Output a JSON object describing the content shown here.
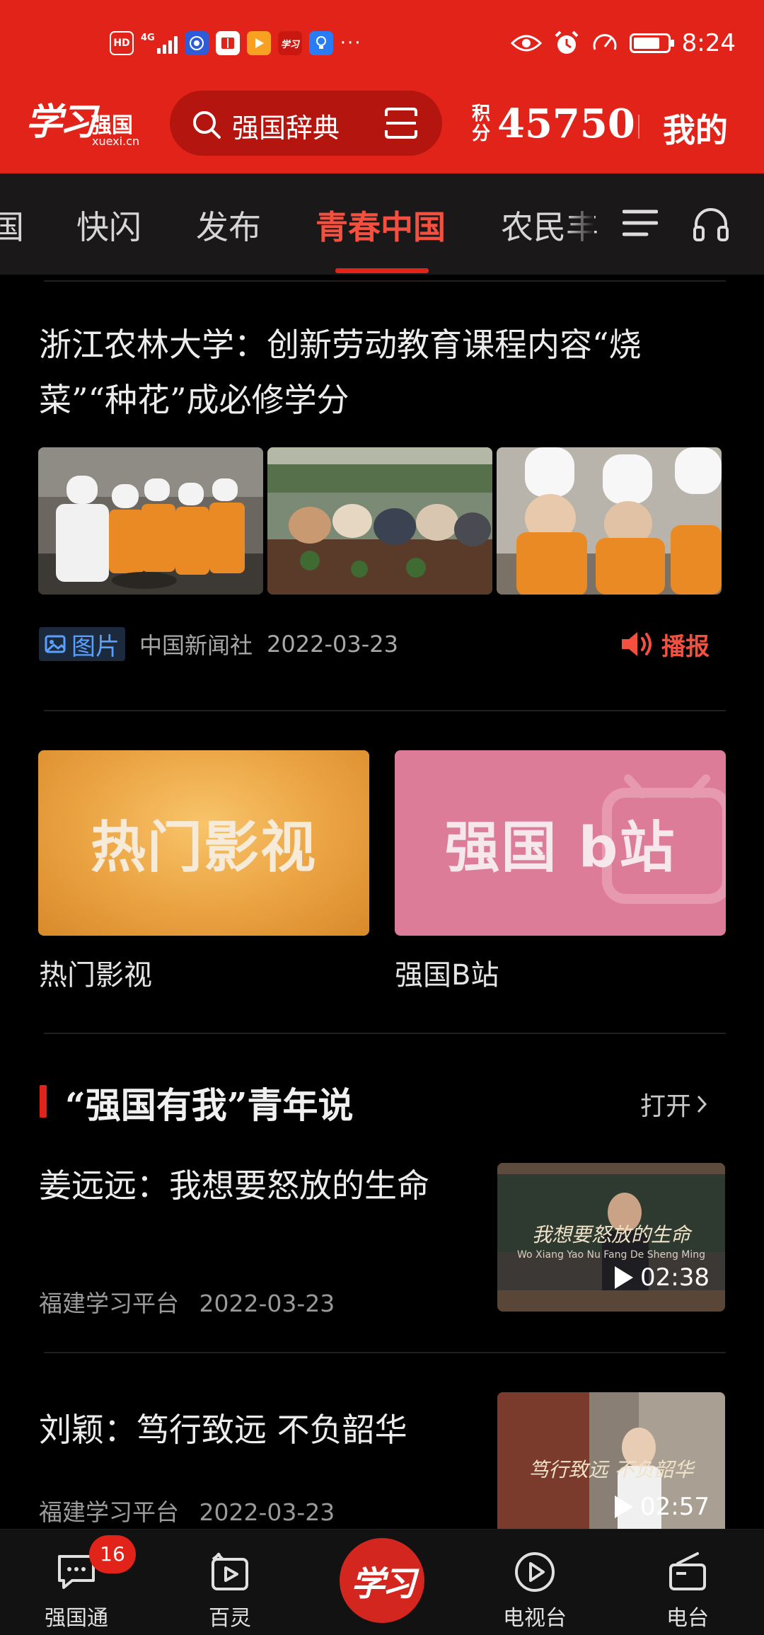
{
  "status_bar": {
    "time": "8:24",
    "network": "4G",
    "left_icons": [
      "hd-icon",
      "signal-icon",
      "app-blue-icon",
      "book-icon",
      "play-orange-icon",
      "xuexi-icon",
      "bulb-icon",
      "more-dots-icon"
    ],
    "hd_label": "HD",
    "battery_level": 0.7
  },
  "header": {
    "logo_script": "学习",
    "logo_name": "强国",
    "logo_url": "xuexi.cn",
    "search_text": "强国辞典",
    "points_label": "积分",
    "points_value": "45750",
    "mine_label": "我的"
  },
  "tabs": {
    "items": [
      "国",
      "快闪",
      "发布",
      "青春中国",
      "农民丰"
    ],
    "active_index": 3
  },
  "article": {
    "title": "浙江农林大学：创新劳动教育课程内容“烧菜”“种花”成必修学分",
    "tag_label": "图片",
    "source": "中国新闻社",
    "date": "2022-03-23",
    "broadcast_label": "播报"
  },
  "cards": [
    {
      "image_text": "热门影视",
      "label": "热门影视"
    },
    {
      "image_text": "强国 b站",
      "label": "强国B站"
    }
  ],
  "section": {
    "title": "“强国有我”青年说",
    "open_label": "打开"
  },
  "news": [
    {
      "title": "姜远远：我想要怒放的生命",
      "source": "福建学习平台",
      "date": "2022-03-23",
      "duration": "02:38",
      "thumb_caption": "我想要怒放的生命",
      "thumb_sub": "Wo Xiang Yao Nu Fang De Sheng Ming"
    },
    {
      "title": "刘颖：笃行致远 不负韶华",
      "source": "福建学习平台",
      "date": "2022-03-23",
      "duration": "02:57",
      "thumb_caption": "笃行致远 不负韶华"
    }
  ],
  "bottom_nav": {
    "items": [
      {
        "label": "强国通",
        "icon": "chat-icon",
        "badge": "16"
      },
      {
        "label": "百灵",
        "icon": "bailing-icon"
      },
      {
        "label": "学习",
        "icon": "xuexi-center-icon"
      },
      {
        "label": "电视台",
        "icon": "tv-play-icon"
      },
      {
        "label": "电台",
        "icon": "radio-icon"
      }
    ]
  },
  "colors": {
    "brand_red": "#e2231a",
    "active_tab": "#f4503f",
    "link_blue": "#5aa0ff"
  }
}
